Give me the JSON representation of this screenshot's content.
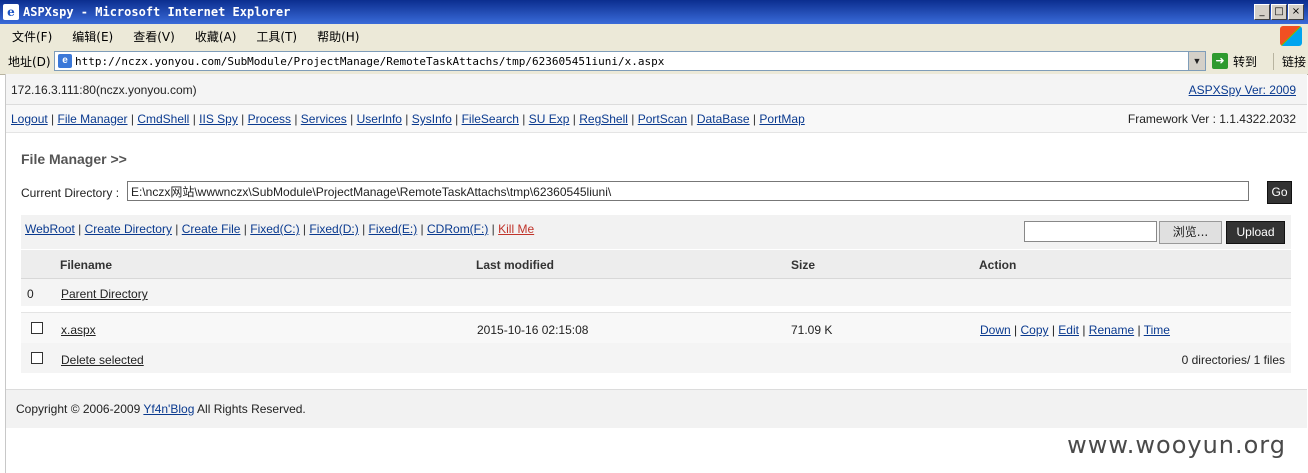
{
  "window": {
    "title": "ASPXspy - Microsoft Internet Explorer",
    "controls": [
      "_",
      "□",
      "×"
    ]
  },
  "menu": [
    "文件(F)",
    "编辑(E)",
    "查看(V)",
    "收藏(A)",
    "工具(T)",
    "帮助(H)"
  ],
  "address_bar": {
    "label": "地址(D)",
    "url": "http://nczx.yonyou.com/SubModule/ProjectManage/RemoteTaskAttachs/tmp/623605451iuni/x.aspx",
    "go_label": "转到",
    "links_label": "链接"
  },
  "header": {
    "host": "172.16.3.111:80(nczx.yonyou.com)",
    "version_link": "ASPXSpy Ver: 2009",
    "framework": "Framework Ver : 1.1.4322.2032"
  },
  "nav": [
    "Logout",
    "File Manager",
    "CmdShell",
    "IIS Spy",
    "Process",
    "Services",
    "UserInfo",
    "SysInfo",
    "FileSearch",
    "SU Exp",
    "RegShell",
    "PortScan",
    "DataBase",
    "PortMap"
  ],
  "file_manager": {
    "title": "File Manager >>",
    "current_dir_label": "Current Directory :",
    "current_dir": "E:\\nczx网站\\wwwnczx\\SubModule\\ProjectManage\\RemoteTaskAttachs\\tmp\\62360545liuni\\",
    "go_label": "Go",
    "tools": [
      "WebRoot",
      "Create Directory",
      "Create File",
      "Fixed(C:)",
      "Fixed(D:)",
      "Fixed(E:)",
      "CDRom(F:)"
    ],
    "kill_label": "Kill Me",
    "browse_label": "浏览...",
    "upload_label": "Upload"
  },
  "table": {
    "headers": {
      "filename": "Filename",
      "modified": "Last modified",
      "size": "Size",
      "action": "Action"
    },
    "parent": {
      "num": "0",
      "label": "Parent Directory"
    },
    "files": [
      {
        "name": "x.aspx",
        "modified": "2015-10-16 02:15:08",
        "size": "71.09 K",
        "actions": [
          "Down",
          "Copy",
          "Edit",
          "Rename",
          "Time"
        ]
      }
    ],
    "delete_label": "Delete selected",
    "summary": "0 directories/ 1 files"
  },
  "footer": {
    "prefix": "Copyright © 2006-2009 ",
    "link": "Yf4n'Blog",
    "suffix": " All Rights Reserved."
  },
  "watermark": "www.wooyun.org"
}
